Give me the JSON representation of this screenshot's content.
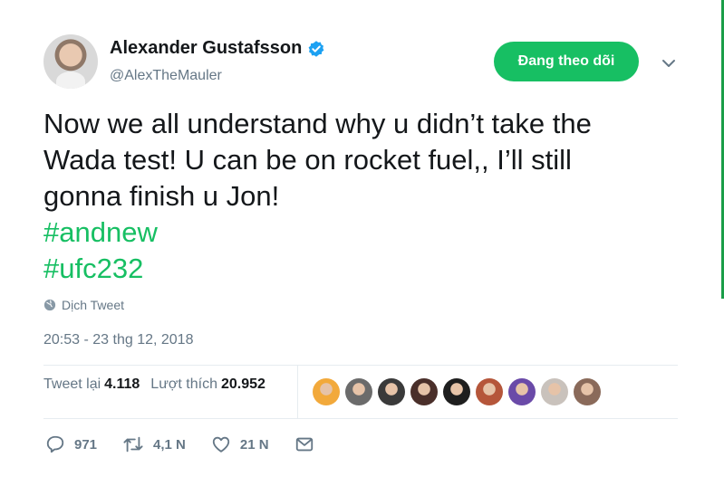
{
  "author": {
    "display_name": "Alexander Gustafsson",
    "handle": "@AlexTheMauler",
    "verified_icon": "verified-badge-icon"
  },
  "follow_button": {
    "label": "Đang theo dõi",
    "color": "#17bf63"
  },
  "tweet": {
    "text": "Now we all understand why u didn’t take the\nWada test! U can be on rocket fuel,, I’ll still\ngonna finish u Jon!",
    "hashtags": [
      "#andnew",
      "#ufc232"
    ],
    "hashtag_color": "#17bf63"
  },
  "translate_label": "Dịch Tweet",
  "timestamp": "20:53 - 23 thg 12, 2018",
  "stats": {
    "retweets_label": "Tweet lại",
    "retweets_count": "4.118",
    "likes_label": "Lượt thích",
    "likes_count": "20.952"
  },
  "likers": [
    {
      "color": "#f2a93b"
    },
    {
      "color": "#6b6b6b"
    },
    {
      "color": "#3a3a3a"
    },
    {
      "color": "#4a2f2a"
    },
    {
      "color": "#1e1e1e"
    },
    {
      "color": "#b5563a"
    },
    {
      "color": "#6a4aa8"
    },
    {
      "color": "#c9c2bc"
    },
    {
      "color": "#8a6a5a"
    }
  ],
  "actions": {
    "reply_count": "971",
    "retweet_count": "4,1 N",
    "like_count": "21 N"
  }
}
